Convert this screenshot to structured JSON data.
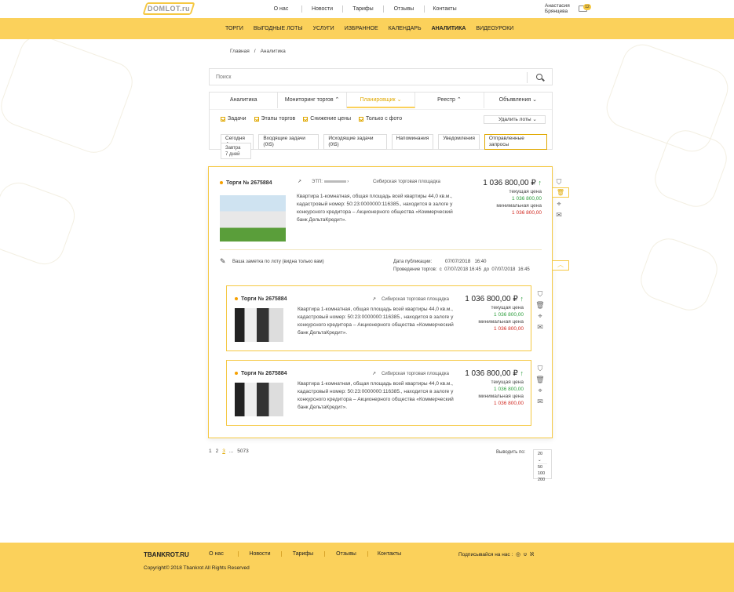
{
  "header": {
    "logo": "DOMLOT.ru",
    "nav": [
      "О нас",
      "Новости",
      "Тарифы",
      "Отзывы",
      "Контакты"
    ],
    "user_first": "Анастасия",
    "user_last": "Брянцева",
    "cart_count": "12"
  },
  "main_nav": [
    {
      "label": "ТОРГИ",
      "active": false
    },
    {
      "label": "ВЫГОДНЫЕ  ЛОТЫ",
      "active": false
    },
    {
      "label": "УСЛУГИ",
      "active": false
    },
    {
      "label": "ИЗБРАННОЕ",
      "active": false
    },
    {
      "label": "КАЛЕНДАРЬ",
      "active": false
    },
    {
      "label": "АНАЛИТИКА",
      "active": true
    },
    {
      "label": "ВИДЕОУРОКИ",
      "active": false
    }
  ],
  "breadcrumb": {
    "home": "Главная",
    "sep": "/",
    "current": "Аналитика"
  },
  "search": {
    "placeholder": "Поиск"
  },
  "tabs": [
    "Аналитика",
    "Мониторинг торгов",
    "Планировщик",
    "Реестр",
    "Объявления"
  ],
  "filters": [
    "Задачи",
    "Этапы торгов",
    "Снижение цены",
    "Только с фото"
  ],
  "delete_lots": "Удалить лоты",
  "chips": [
    "Сегодня",
    "Входящие задачи (0\\5)",
    "Исходящие задачи (0\\5)",
    "Напоминания",
    "Уведомления",
    "Отправленные запросы"
  ],
  "day_options": [
    "Завтра",
    "7 дней"
  ],
  "lot": {
    "title": "Торги № 2675884",
    "etp_label": "ЭТП:",
    "platform": "Сибирская торговая площадка",
    "description": "Квартира 1-комнатная, общая площадь всей квартиры 44,0 кв.м., кадастровый номер: 50:23:0000000:116385., находится в залоге у конкурсного кредитора – Акционерного общества «Коммерческий банк ДельтаКредит».",
    "price": "1 036 800,00 ₽",
    "current_label": "текущая цена",
    "current_price": "1 036 800,00",
    "min_label": "минимальная цена",
    "min_price": "1 036 800,00",
    "note": "Ваша заметка по лоту (видна только вам)",
    "pub_label": "Дата публикации:",
    "pub_date": "07/07/2018",
    "pub_time": "16:40",
    "hold_label": "Проведение торгов:",
    "from": "с",
    "from_date": "07/07/2018",
    "from_time": "16:45",
    "to": "до",
    "to_date": "07/07/2018",
    "to_time": "16:45"
  },
  "subcards": [
    {
      "title": "Торги № 2675884",
      "platform": "Сибирская торговая площадка"
    },
    {
      "title": "Торги № 2675884",
      "platform": "Сибирская торговая площадка"
    }
  ],
  "pager": [
    "1",
    "2",
    "3",
    "...",
    "5073"
  ],
  "per_page_label": "Выводить по:",
  "per_page_options": [
    "20",
    "50",
    "100",
    "200"
  ],
  "footer": {
    "brand": "TBANKROT.RU",
    "nav": [
      "О нас",
      "Новости",
      "Тарифы",
      "Отзывы",
      "Контакты"
    ],
    "subscribe": "Подписывайся на нас :",
    "copyright": "Copyright© 2018 Tbankrot All Rights Reserved"
  }
}
